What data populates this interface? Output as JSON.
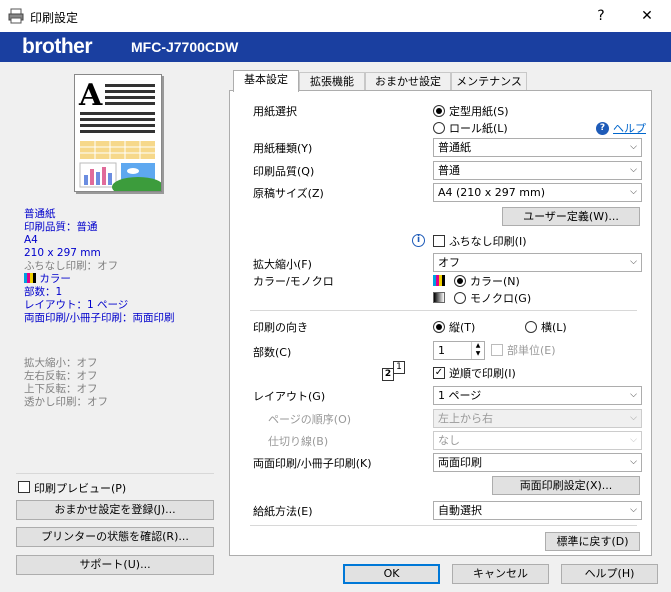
{
  "window": {
    "title": "印刷設定",
    "help_btn": "?",
    "close_btn": "✕"
  },
  "banner": {
    "logo": "brother",
    "model": "MFC-J7700CDW"
  },
  "summary": {
    "lines_blue": [
      "普通紙",
      "印刷品質：普通",
      "A4",
      "210 x 297 mm"
    ],
    "borderless": "ふちなし印刷：オフ",
    "color": "カラー",
    "copies": "部数：1",
    "layout": "レイアウト：1 ページ",
    "duplex": "両面印刷/小冊子印刷：両面印刷",
    "gray_lines": [
      "拡大縮小：オフ",
      "左右反転：オフ",
      "上下反転：オフ",
      "透かし印刷：オフ"
    ]
  },
  "left_buttons": {
    "preview": "印刷プレビュー(P)",
    "register": "おまかせ設定を登録(J)...",
    "status": "プリンターの状態を確認(R)...",
    "support": "サポート(U)..."
  },
  "tabs": [
    "基本設定",
    "拡張機能",
    "おまかせ設定",
    "メンテナンス"
  ],
  "basic": {
    "paper_select_label": "用紙選択",
    "paper_std": "定型用紙(S)",
    "paper_roll": "ロール紙(L)",
    "help_link": "ヘルプ",
    "media_label": "用紙種類(Y)",
    "media_value": "普通紙",
    "quality_label": "印刷品質(Q)",
    "quality_value": "普通",
    "size_label": "原稿サイズ(Z)",
    "size_value": "A4 (210 x 297 mm)",
    "user_size_btn": "ユーザー定義(W)...",
    "borderless": "ふちなし印刷(I)",
    "scale_label": "拡大縮小(F)",
    "scale_value": "オフ",
    "color_label": "カラー/モノクロ",
    "color_opt": "カラー(N)",
    "mono_opt": "モノクロ(G)",
    "orient_label": "印刷の向き",
    "portrait": "縦(T)",
    "landscape": "横(L)",
    "copies_label": "部数(C)",
    "copies_value": "1",
    "collate": "部単位(E)",
    "reverse": "逆順で印刷(I)",
    "reverse_icon_nums": [
      "1",
      "2"
    ],
    "layout_label": "レイアウト(G)",
    "layout_value": "1 ページ",
    "page_order_label": "ページの順序(O)",
    "page_order_value": "左上から右",
    "border_label": "仕切り線(B)",
    "border_value": "なし",
    "duplex_label": "両面印刷/小冊子印刷(K)",
    "duplex_value": "両面印刷",
    "duplex_btn": "両面印刷設定(X)...",
    "source_label": "給紙方法(E)",
    "source_value": "自動選択",
    "default_btn": "標準に戻す(D)"
  },
  "dialog": {
    "ok": "OK",
    "cancel": "キャンセル",
    "help": "ヘルプ(H)"
  },
  "colors": {
    "banner": "#1a3fa0",
    "link": "#0066cc",
    "summary_text": "#0000cc"
  }
}
